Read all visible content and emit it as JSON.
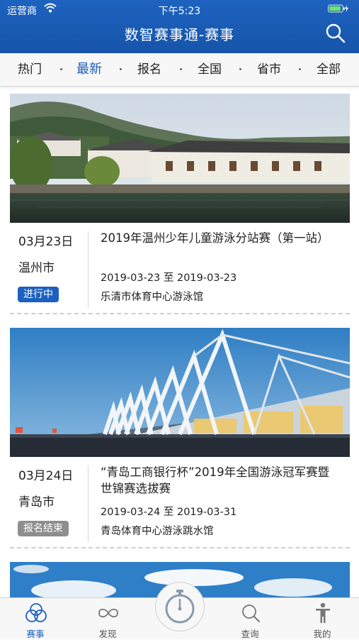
{
  "status": {
    "carrier": "运营商",
    "time": "下午5:23"
  },
  "header": {
    "title": "数智赛事通-赛事"
  },
  "tabs": [
    "热门",
    "最新",
    "报名",
    "全国",
    "省市",
    "全部"
  ],
  "active_tab": "最新",
  "events": [
    {
      "date": "03月23日",
      "city": "温州市",
      "status": "进行中",
      "title": "2019年温州少年儿童游泳分站赛（第一站）",
      "dates": "2019-03-23 至 2019-03-23",
      "venue": "乐清市体育中心游泳馆"
    },
    {
      "date": "03月24日",
      "city": "青岛市",
      "status": "报名结束",
      "title": "“青岛工商银行杯”2019年全国游泳冠军赛暨世锦赛选拔赛",
      "dates": "2019-03-24 至 2019-03-31",
      "venue": "青岛体育中心游泳跳水馆"
    }
  ],
  "bottom_nav": [
    {
      "label": "赛事",
      "icon": "rings-icon"
    },
    {
      "label": "发现",
      "icon": "infinity-icon"
    },
    {
      "label": "",
      "icon": "stopwatch-icon"
    },
    {
      "label": "查询",
      "icon": "search-icon"
    },
    {
      "label": "我的",
      "icon": "person-icon"
    }
  ],
  "colors": {
    "primary": "#1c60c0",
    "badge_active": "#1c60c0",
    "badge_closed": "#8e8e8e"
  }
}
